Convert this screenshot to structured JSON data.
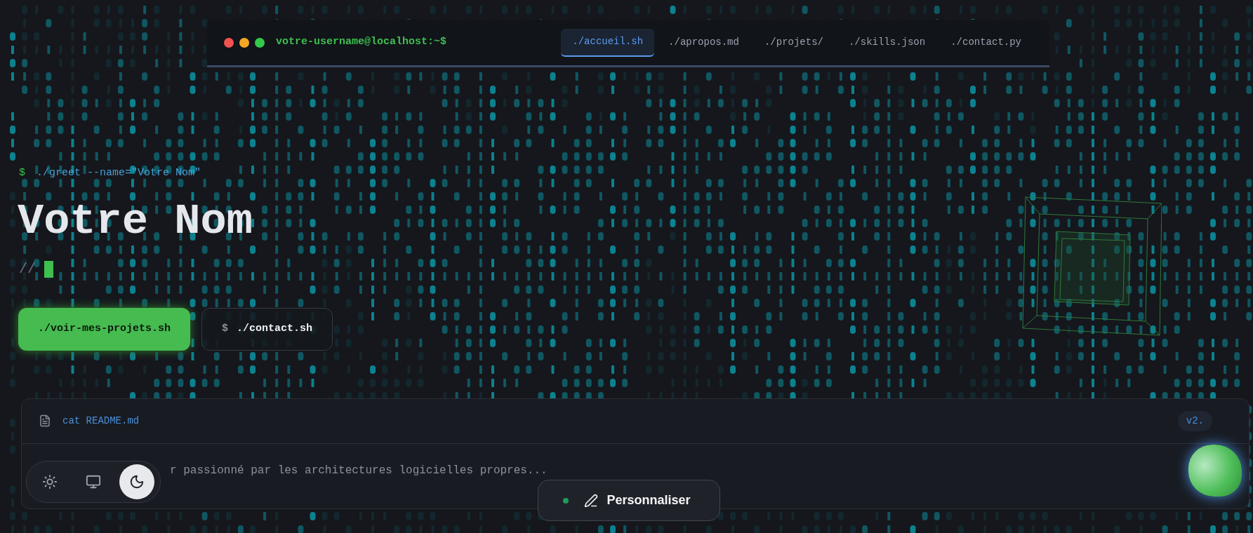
{
  "nav": {
    "prompt": "votre-username@localhost:~$",
    "tabs": [
      {
        "label": "./accueil.sh",
        "selected": true
      },
      {
        "label": "./apropos.md",
        "selected": false
      },
      {
        "label": "./projets/",
        "selected": false
      },
      {
        "label": "./skills.json",
        "selected": false
      },
      {
        "label": "./contact.py",
        "selected": false
      }
    ]
  },
  "hero": {
    "prompt": "$",
    "command": "./greet --name=\"Votre Nom\"",
    "name": "Votre Nom",
    "comment": "//",
    "buttons": [
      {
        "kind": "primary",
        "label": "./voir-mes-projets.sh"
      },
      {
        "kind": "secondary",
        "prefix": "$",
        "label": "./contact.sh"
      }
    ]
  },
  "readme": {
    "command": "cat README.md",
    "version": "v2.",
    "text": "r passionné par les architectures logicielles propres..."
  },
  "theme_switcher": [
    {
      "kind": "light",
      "selected": false
    },
    {
      "kind": "system",
      "selected": false
    },
    {
      "kind": "dark",
      "selected": true
    }
  ],
  "customize_button": {
    "label": "Personnaliser"
  }
}
